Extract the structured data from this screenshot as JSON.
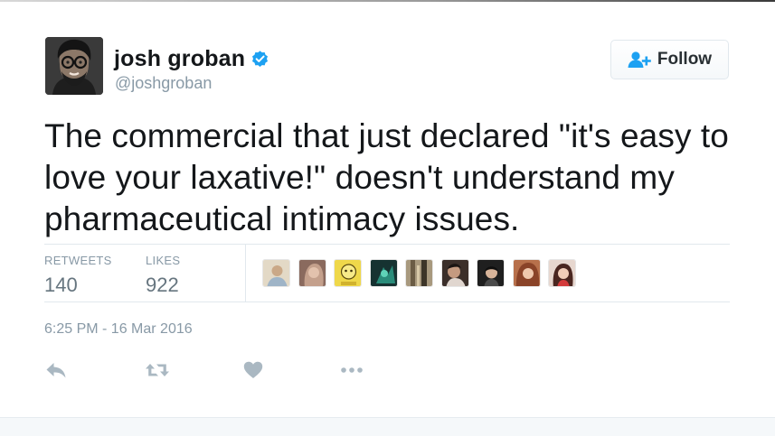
{
  "user": {
    "display_name": "josh groban",
    "handle": "@joshgroban",
    "verified": true,
    "verified_color": "#1da1f2",
    "avatar_icon": "profile-photo"
  },
  "follow_button": {
    "label": "Follow",
    "icon": "follow-person-plus-icon",
    "accent": "#1da1f2"
  },
  "tweet": {
    "text": "The commercial that just declared \"it's easy to love your laxative!\" doesn't understand my pharmaceutical intimacy issues.",
    "timestamp": "6:25 PM - 16 Mar 2016"
  },
  "stats": {
    "retweets_label": "RETWEETS",
    "retweets_count": "140",
    "likes_label": "LIKES",
    "likes_count": "922"
  },
  "likers": [
    {
      "icon": "liker-avatar-1",
      "bg": "#d9cbb0"
    },
    {
      "icon": "liker-avatar-2",
      "bg": "#b38f7a"
    },
    {
      "icon": "liker-avatar-3",
      "bg": "#e6d23a"
    },
    {
      "icon": "liker-avatar-4",
      "bg": "#1f3b3a"
    },
    {
      "icon": "liker-avatar-5",
      "bg": "#8b7a62"
    },
    {
      "icon": "liker-avatar-6",
      "bg": "#4a3d36"
    },
    {
      "icon": "liker-avatar-7",
      "bg": "#2b2b2b"
    },
    {
      "icon": "liker-avatar-8",
      "bg": "#a8613f"
    },
    {
      "icon": "liker-avatar-9",
      "bg": "#5c3a34"
    }
  ],
  "actions": [
    {
      "name": "reply-icon"
    },
    {
      "name": "retweet-icon"
    },
    {
      "name": "like-heart-icon"
    },
    {
      "name": "more-options-icon"
    }
  ],
  "colors": {
    "text": "#14171a",
    "secondary": "#8899a6",
    "stat_value": "#66757f",
    "action_icon": "#aab8c2",
    "divider": "#e1e8ed"
  }
}
